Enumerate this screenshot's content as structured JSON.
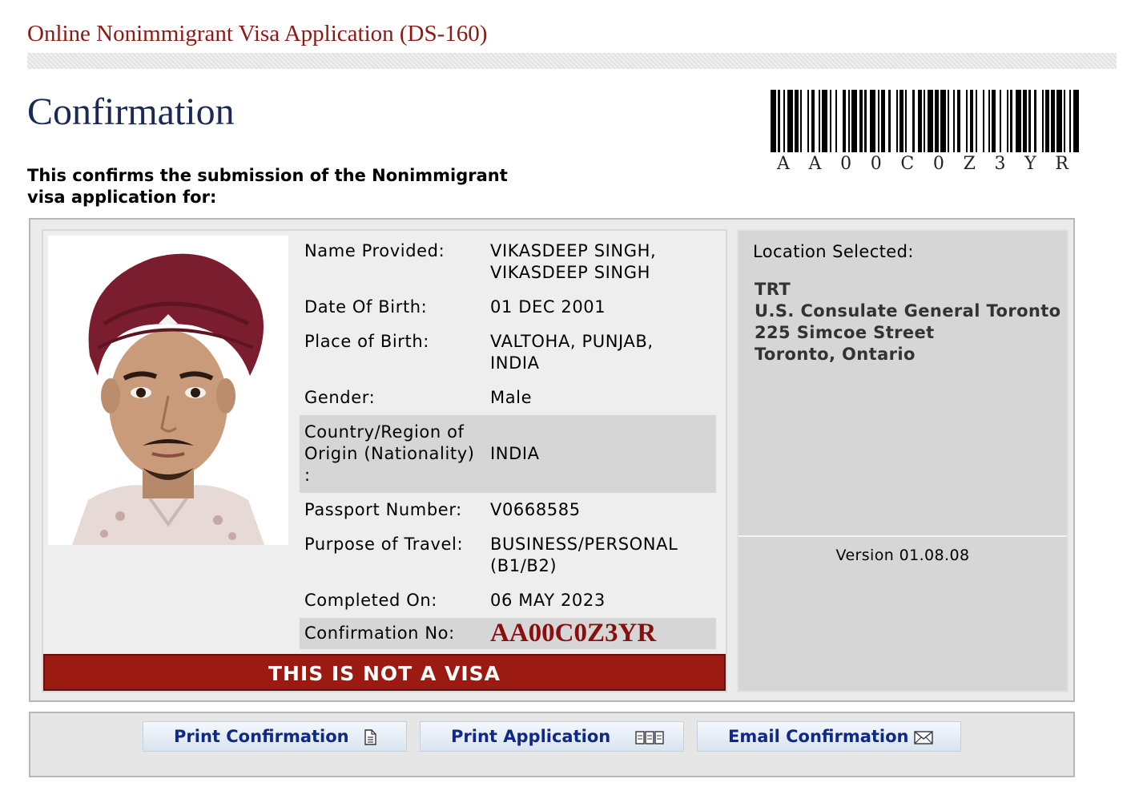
{
  "app_title": "Online Nonimmigrant Visa Application (DS-160)",
  "page_title": "Confirmation",
  "barcode": {
    "text": [
      "A",
      "A",
      "0",
      "0",
      "C",
      "0",
      "Z",
      "3",
      "Y",
      "R"
    ]
  },
  "intro": {
    "line1": "This confirms the submission of the Nonimmigrant",
    "line2": "visa application for:"
  },
  "applicant": {
    "name_label": "Name Provided:",
    "name_line1": "VIKASDEEP SINGH,",
    "name_line2": "VIKASDEEP SINGH",
    "dob_label": "Date Of Birth:",
    "dob": "01 DEC 2001",
    "pob_label": "Place of Birth:",
    "pob_line1": "VALTOHA, PUNJAB,",
    "pob_line2": "INDIA",
    "gender_label": "Gender:",
    "gender": "Male",
    "origin_label_line1": "Country/Region of",
    "origin_label_line2": "Origin (Nationality)",
    "origin_label_line3": ":",
    "origin": "INDIA",
    "passport_label": "Passport Number:",
    "passport": "V0668585",
    "purpose_label": "Purpose of Travel:",
    "purpose_line1": "BUSINESS/PERSONAL",
    "purpose_line2": "(B1/B2)",
    "completed_label": "Completed On:",
    "completed": "06 MAY 2023",
    "confirmation_label": "Confirmation No:",
    "confirmation": "AA00C0Z3YR"
  },
  "banner": "THIS IS NOT A VISA",
  "location": {
    "label": "Location Selected:",
    "code": "TRT",
    "name": "U.S. Consulate General Toronto",
    "street": "225 Simcoe Street",
    "city": "Toronto, Ontario"
  },
  "version": "Version 01.08.08",
  "actions": {
    "print_confirmation": "Print Confirmation",
    "print_application": "Print Application",
    "email_confirmation": "Email Confirmation"
  },
  "icons": {
    "print_confirmation": "document-icon",
    "print_application": "pages-icon",
    "email_confirmation": "envelope-icon"
  },
  "colors": {
    "app_title": "#8a1a12",
    "page_title": "#1b2a55",
    "banner_bg": "#9b1a12",
    "confirmation_no": "#8b0e0e",
    "button_text": "#10288a"
  }
}
